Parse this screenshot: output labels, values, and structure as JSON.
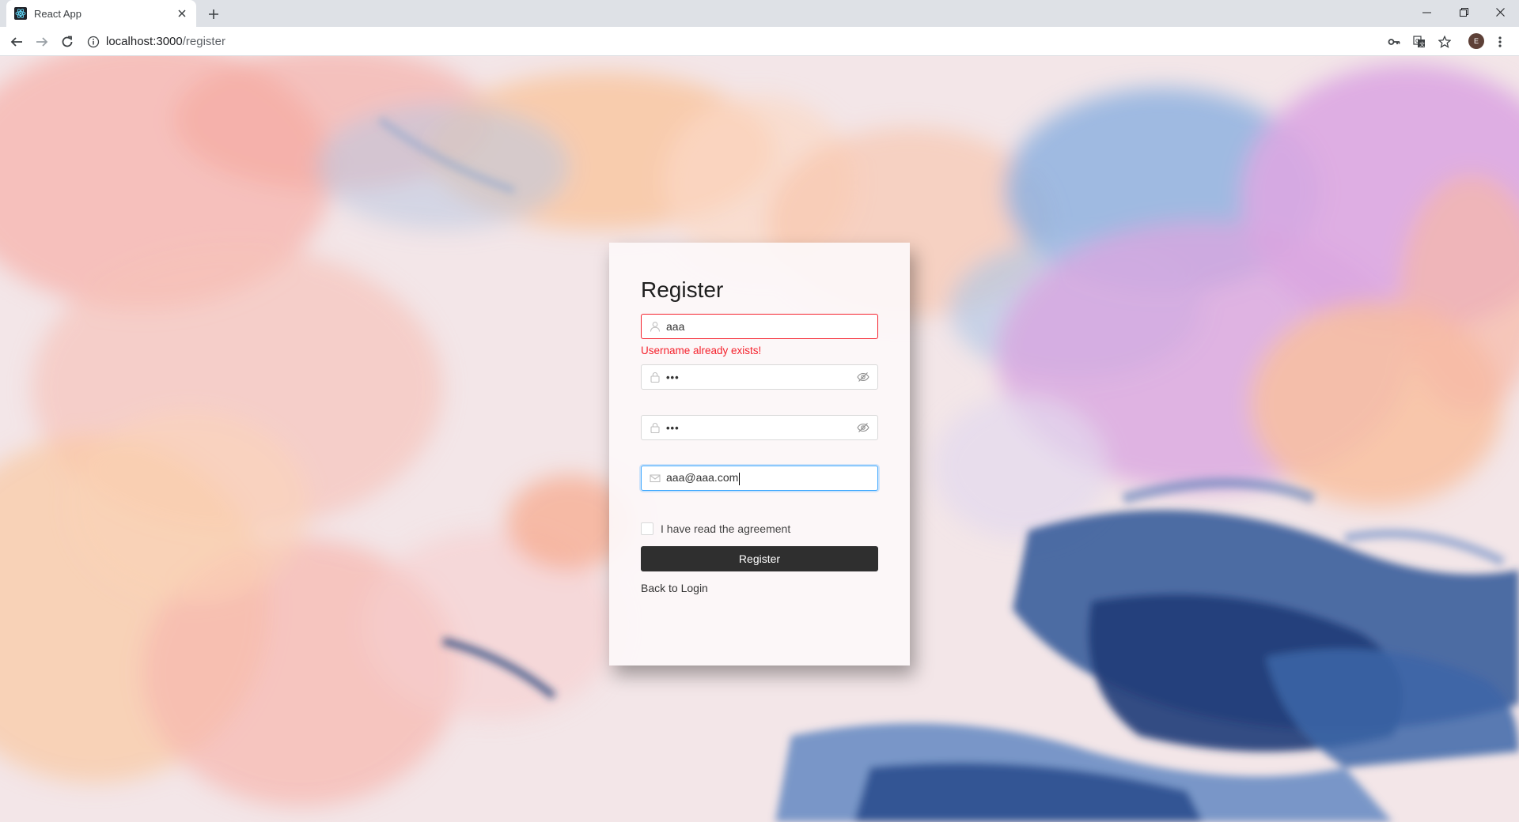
{
  "browser": {
    "tab_title": "React App",
    "url_host": "localhost:3000",
    "url_path": "/register",
    "profile_initial": "E"
  },
  "form": {
    "title": "Register",
    "username_value": "aaa",
    "username_error": "Username already exists!",
    "password_value": "•••",
    "confirm_value": "•••",
    "email_value": "aaa@aaa.com",
    "agreement_label": "I have read the agreement",
    "agreement_checked": false,
    "register_label": "Register",
    "back_label": "Back to Login"
  },
  "colors": {
    "error": "#f5222d",
    "focus": "#40a9ff",
    "button": "#2f2f2f"
  }
}
